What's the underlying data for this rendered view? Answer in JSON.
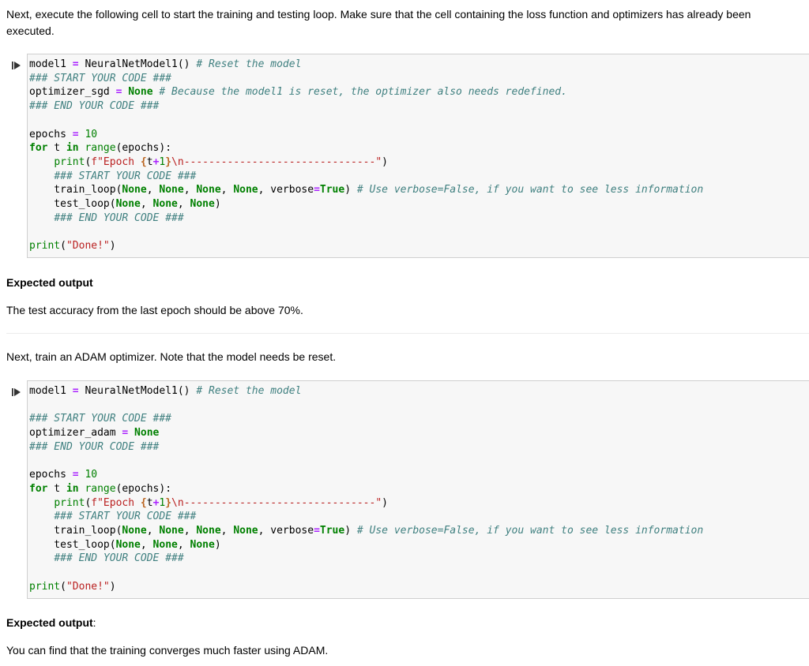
{
  "intro": {
    "text": "Next, execute the following cell to start the training and testing loop. Make sure that the cell containing the loss function and optimizers has already been executed."
  },
  "cell1": {
    "lines": [
      [
        [
          "",
          "model1 "
        ],
        [
          "op",
          "="
        ],
        [
          "",
          " NeuralNetModel1() "
        ],
        [
          "cm",
          "# Reset the model"
        ]
      ],
      [
        [
          "cm",
          "### START YOUR CODE ###"
        ]
      ],
      [
        [
          "",
          "optimizer_sgd "
        ],
        [
          "op",
          "="
        ],
        [
          "kw",
          " None"
        ],
        [
          "",
          " "
        ],
        [
          "cm",
          "# Because the model1 is reset, the optimizer also needs redefined."
        ]
      ],
      [
        [
          "cm",
          "### END YOUR CODE ###"
        ]
      ],
      [],
      [
        [
          "",
          "epochs "
        ],
        [
          "op",
          "="
        ],
        [
          "",
          " "
        ],
        [
          "nm",
          "10"
        ]
      ],
      [
        [
          "kw",
          "for"
        ],
        [
          "",
          " t "
        ],
        [
          "kw",
          "in"
        ],
        [
          "",
          " "
        ],
        [
          "bi",
          "range"
        ],
        [
          "",
          "(epochs):"
        ]
      ],
      [
        [
          "",
          "    "
        ],
        [
          "bi",
          "print"
        ],
        [
          "",
          "("
        ],
        [
          "st",
          "f\"Epoch "
        ],
        [
          "sp",
          "{"
        ],
        [
          "",
          "t"
        ],
        [
          "op",
          "+"
        ],
        [
          "nm",
          "1"
        ],
        [
          "sp",
          "}"
        ],
        [
          "st",
          "\\n-------------------------------\""
        ],
        [
          "",
          ")"
        ]
      ],
      [
        [
          "",
          "    "
        ],
        [
          "cm",
          "### START YOUR CODE ###"
        ]
      ],
      [
        [
          "",
          "    train_loop("
        ],
        [
          "kw",
          "None"
        ],
        [
          "",
          ", "
        ],
        [
          "kw",
          "None"
        ],
        [
          "",
          ", "
        ],
        [
          "kw",
          "None"
        ],
        [
          "",
          ", "
        ],
        [
          "kw",
          "None"
        ],
        [
          "",
          ", verbose"
        ],
        [
          "op",
          "="
        ],
        [
          "kw",
          "True"
        ],
        [
          "",
          ") "
        ],
        [
          "cm",
          "# Use verbose=False, if you want to see less information"
        ]
      ],
      [
        [
          "",
          "    test_loop("
        ],
        [
          "kw",
          "None"
        ],
        [
          "",
          ", "
        ],
        [
          "kw",
          "None"
        ],
        [
          "",
          ", "
        ],
        [
          "kw",
          "None"
        ],
        [
          "",
          ")"
        ]
      ],
      [
        [
          "",
          "    "
        ],
        [
          "cm",
          "### END YOUR CODE ###"
        ]
      ],
      [],
      [
        [
          "bi",
          "print"
        ],
        [
          "",
          "("
        ],
        [
          "st",
          "\"Done!\""
        ],
        [
          "",
          ")"
        ]
      ]
    ]
  },
  "expected1": {
    "heading": "Expected output",
    "text": "The test accuracy from the last epoch should be above 70%."
  },
  "adam_intro": {
    "text": "Next, train an ADAM optimizer. Note that the model needs be reset."
  },
  "cell2": {
    "lines": [
      [
        [
          "",
          "model1 "
        ],
        [
          "op",
          "="
        ],
        [
          "",
          " NeuralNetModel1() "
        ],
        [
          "cm",
          "# Reset the model"
        ]
      ],
      [],
      [
        [
          "cm",
          "### START YOUR CODE ###"
        ]
      ],
      [
        [
          "",
          "optimizer_adam "
        ],
        [
          "op",
          "="
        ],
        [
          "kw",
          " None"
        ]
      ],
      [
        [
          "cm",
          "### END YOUR CODE ###"
        ]
      ],
      [],
      [
        [
          "",
          "epochs "
        ],
        [
          "op",
          "="
        ],
        [
          "",
          " "
        ],
        [
          "nm",
          "10"
        ]
      ],
      [
        [
          "kw",
          "for"
        ],
        [
          "",
          " t "
        ],
        [
          "kw",
          "in"
        ],
        [
          "",
          " "
        ],
        [
          "bi",
          "range"
        ],
        [
          "",
          "(epochs):"
        ]
      ],
      [
        [
          "",
          "    "
        ],
        [
          "bi",
          "print"
        ],
        [
          "",
          "("
        ],
        [
          "st",
          "f\"Epoch "
        ],
        [
          "sp",
          "{"
        ],
        [
          "",
          "t"
        ],
        [
          "op",
          "+"
        ],
        [
          "nm",
          "1"
        ],
        [
          "sp",
          "}"
        ],
        [
          "st",
          "\\n-------------------------------\""
        ],
        [
          "",
          ")"
        ]
      ],
      [
        [
          "",
          "    "
        ],
        [
          "cm",
          "### START YOUR CODE ###"
        ]
      ],
      [
        [
          "",
          "    train_loop("
        ],
        [
          "kw",
          "None"
        ],
        [
          "",
          ", "
        ],
        [
          "kw",
          "None"
        ],
        [
          "",
          ", "
        ],
        [
          "kw",
          "None"
        ],
        [
          "",
          ", "
        ],
        [
          "kw",
          "None"
        ],
        [
          "",
          ", verbose"
        ],
        [
          "op",
          "="
        ],
        [
          "kw",
          "True"
        ],
        [
          "",
          ") "
        ],
        [
          "cm",
          "# Use verbose=False, if you want to see less information"
        ]
      ],
      [
        [
          "",
          "    test_loop("
        ],
        [
          "kw",
          "None"
        ],
        [
          "",
          ", "
        ],
        [
          "kw",
          "None"
        ],
        [
          "",
          ", "
        ],
        [
          "kw",
          "None"
        ],
        [
          "",
          ")"
        ]
      ],
      [
        [
          "",
          "    "
        ],
        [
          "cm",
          "### END YOUR CODE ###"
        ]
      ],
      [],
      [
        [
          "bi",
          "print"
        ],
        [
          "",
          "("
        ],
        [
          "st",
          "\"Done!\""
        ],
        [
          "",
          ")"
        ]
      ]
    ]
  },
  "expected2": {
    "heading": "Expected output",
    "colon": ":",
    "text": "You can find that the training converges much faster using ADAM."
  },
  "icons": {
    "run": "run-cell-icon"
  }
}
